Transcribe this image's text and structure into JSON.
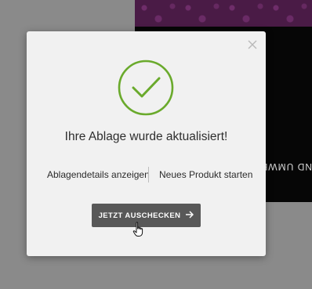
{
  "background": {
    "vertical_text": "ND UMWE"
  },
  "modal": {
    "close_icon": "close-icon",
    "success_icon": "checkmark-circle-icon",
    "title": "Ihre Ablage wurde aktualisiert!",
    "link_details": "Ablagendetails anzeigen",
    "link_new_product": "Neues Produkt starten",
    "cta_label": "JETZT AUSCHECKEN",
    "cta_icon": "arrow-right-icon"
  },
  "colors": {
    "success_green": "#6aaa2c",
    "button_bg": "#585858",
    "modal_bg": "#f1f1f1",
    "overlay": "#8a8a8a"
  }
}
